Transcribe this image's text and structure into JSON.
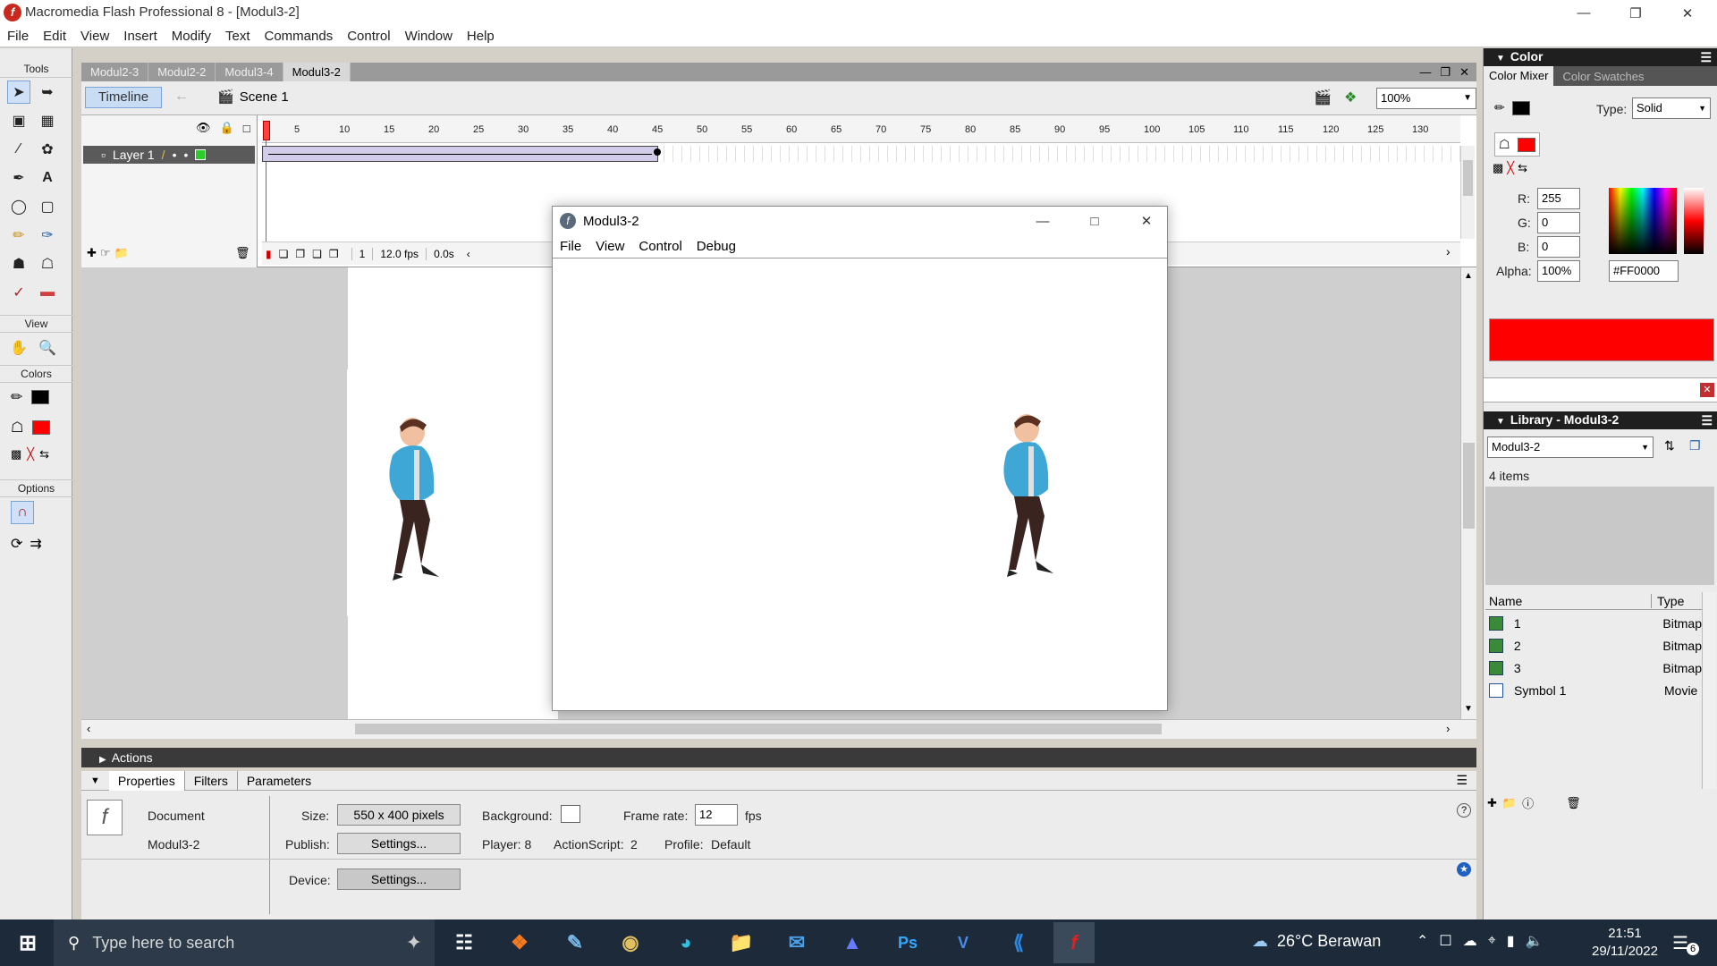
{
  "window": {
    "title": "Macromedia Flash Professional 8 - [Modul3-2]"
  },
  "menu": [
    "File",
    "Edit",
    "View",
    "Insert",
    "Modify",
    "Text",
    "Commands",
    "Control",
    "Window",
    "Help"
  ],
  "tools": {
    "title": "Tools",
    "view_label": "View",
    "colors_label": "Colors",
    "options_label": "Options"
  },
  "doc_tabs": [
    "Modul2-3",
    "Modul2-2",
    "Modul3-4",
    "Modul3-2"
  ],
  "timeline": {
    "button": "Timeline",
    "scene": "Scene 1",
    "zoom": "100%",
    "layer": "Layer 1",
    "ruler": [
      "5",
      "10",
      "15",
      "20",
      "25",
      "30",
      "35",
      "40",
      "45",
      "50",
      "55",
      "60",
      "65",
      "70",
      "75",
      "80",
      "85",
      "90",
      "95",
      "100",
      "105",
      "110",
      "115",
      "120",
      "125",
      "130"
    ],
    "frame": "1",
    "fps": "12.0 fps",
    "time": "0.0s"
  },
  "popup": {
    "title": "Modul3-2",
    "menu": [
      "File",
      "View",
      "Control",
      "Debug"
    ]
  },
  "actions": {
    "label": "Actions"
  },
  "properties": {
    "tabs": [
      "Properties",
      "Filters",
      "Parameters"
    ],
    "doc_type": "Document",
    "doc_name": "Modul3-2",
    "size_label": "Size:",
    "size_value": "550 x 400 pixels",
    "background_label": "Background:",
    "frame_rate_label": "Frame rate:",
    "frame_rate": "12",
    "fps": "fps",
    "publish_label": "Publish:",
    "settings": "Settings...",
    "player": "Player: 8",
    "actionscript_label": "ActionScript:",
    "actionscript": "2",
    "profile_label": "Profile:",
    "profile": "Default",
    "device_label": "Device:"
  },
  "color_panel": {
    "title": "Color",
    "tabs": [
      "Color Mixer",
      "Color Swatches"
    ],
    "type_label": "Type:",
    "type_value": "Solid",
    "r_label": "R:",
    "r": "255",
    "g_label": "G:",
    "g": "0",
    "b_label": "B:",
    "b": "0",
    "alpha_label": "Alpha:",
    "alpha": "100%",
    "hex": "#FF0000",
    "fill_color": "#ff0000"
  },
  "library": {
    "title": "Library - Modul3-2",
    "selected": "Modul3-2",
    "count": "4 items",
    "col_name": "Name",
    "col_type": "Type",
    "items": [
      {
        "name": "1",
        "type": "Bitmap"
      },
      {
        "name": "2",
        "type": "Bitmap"
      },
      {
        "name": "3",
        "type": "Bitmap"
      },
      {
        "name": "Symbol 1",
        "type": "Movie"
      }
    ]
  },
  "taskbar": {
    "search": "Type here to search",
    "weather": "26°C  Berawan",
    "time": "21:51",
    "date": "29/11/2022",
    "notifications": "6"
  }
}
